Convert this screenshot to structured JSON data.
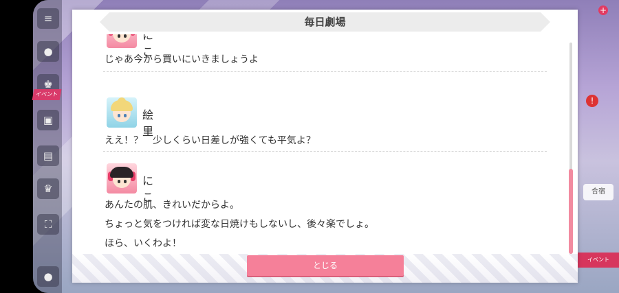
{
  "dialog": {
    "title": "毎日劇場",
    "close_label": "とじる"
  },
  "entries": [
    {
      "speaker": "にこ",
      "lines": [
        "じゃあ今から買いにいきましょうよ"
      ]
    },
    {
      "speaker": "絵里",
      "lines": [
        "ええ！？　少しくらい日差しが強くても平気よ？"
      ]
    },
    {
      "speaker": "にこ",
      "lines": [
        "あんたの肌、きれいだからよ。",
        "ちょっと気をつければ変な日焼けもしないし、後々楽でしょ。",
        "ほら、いくわよ！"
      ]
    }
  ],
  "background": {
    "rail_badge": "イベント",
    "right_pill": "合宿",
    "right_banner": "イベント",
    "right_red_icon": "!",
    "plus_icon": "+"
  },
  "colors": {
    "accent_pink": "#f58099",
    "scroll_thumb": "#f28ba0"
  },
  "icons": [
    "menu-icon",
    "chat-icon",
    "present-icon",
    "gift-icon",
    "screen-icon",
    "trophy-icon",
    "expand-icon",
    "user-icon"
  ]
}
